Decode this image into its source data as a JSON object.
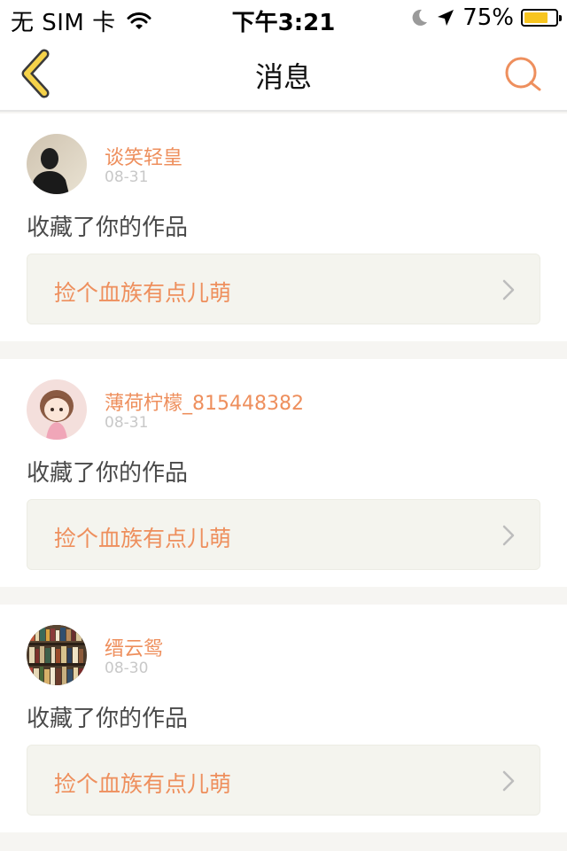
{
  "status_bar": {
    "carrier": "无 SIM 卡",
    "time": "下午3:21",
    "battery": "75%",
    "battery_level": 0.75,
    "icons": [
      "wifi-icon",
      "moon-icon",
      "location-icon",
      "battery-icon"
    ]
  },
  "nav": {
    "title": "消息",
    "back_icon": "chevron-left-icon",
    "search_icon": "search-icon"
  },
  "messages": [
    {
      "username": "谈笑轻皇",
      "date": "08-31",
      "action": "收藏了你的作品",
      "work_title": "捡个血族有点儿萌",
      "avatar": "avatar-silhouette"
    },
    {
      "username": "薄荷柠檬_815448382",
      "date": "08-31",
      "action": "收藏了你的作品",
      "work_title": "捡个血族有点儿萌",
      "avatar": "avatar-cartoon-girl"
    },
    {
      "username": "缙云鸳",
      "date": "08-30",
      "action": "收藏了你的作品",
      "work_title": "捡个血族有点儿萌",
      "avatar": "avatar-bookshelf"
    }
  ],
  "colors": {
    "accent": "#ee8f5d",
    "back_icon": "#f5d24a",
    "date": "#c8c8c8",
    "card_link_bg": "#f4f4ee",
    "page_bg": "#f6f5f2"
  }
}
